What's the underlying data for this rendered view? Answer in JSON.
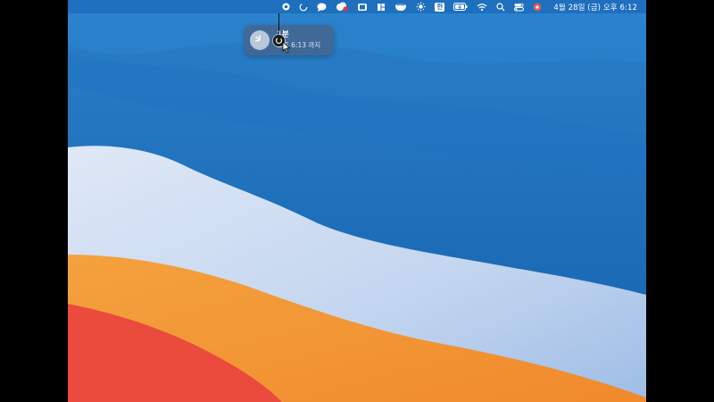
{
  "menubar": {
    "items": [
      {
        "name": "record-icon"
      },
      {
        "name": "timer-icon"
      },
      {
        "name": "chat-icon"
      },
      {
        "name": "creative-cloud-icon"
      },
      {
        "name": "window-icon"
      },
      {
        "name": "layout-icon"
      },
      {
        "name": "bowl-icon"
      },
      {
        "name": "brightness-icon"
      },
      {
        "name": "input-source-icon",
        "label": "한"
      },
      {
        "name": "battery-icon"
      },
      {
        "name": "wifi-icon"
      },
      {
        "name": "search-icon"
      },
      {
        "name": "control-center-icon"
      },
      {
        "name": "app-icon"
      }
    ],
    "clock": "4월 28일 (금) 오후 6:12"
  },
  "timer_popup": {
    "duration": "1분",
    "until": "오후 6:13 까지"
  },
  "colors": {
    "sky_blue": "#1767b2",
    "wave_white": "#c9d8ee",
    "orange": "#f29a36",
    "red": "#ec4a3c"
  }
}
